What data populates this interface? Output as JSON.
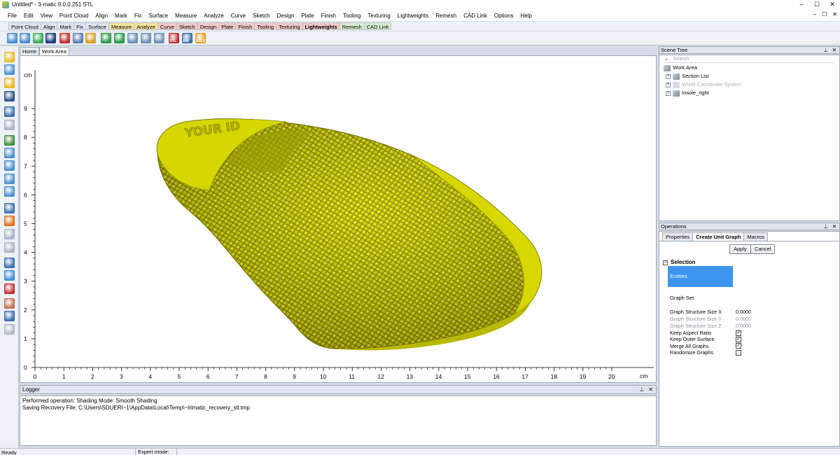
{
  "window": {
    "title": "Untitled* - 3-matic 9.0.0.251 STL",
    "controls": [
      "–",
      "☐",
      "✕"
    ]
  },
  "menubar": {
    "items": [
      "File",
      "Edit",
      "View",
      "Point Cloud",
      "Align",
      "Mark",
      "Fix",
      "Surface",
      "Measure",
      "Analyze",
      "Curve",
      "Sketch",
      "Design",
      "Plate",
      "Finish",
      "Tooling",
      "Texturing",
      "Lightweights",
      "Remesh",
      "CAD Link",
      "Options",
      "Help"
    ],
    "right": [
      "–",
      "☐",
      "✕"
    ]
  },
  "tabstrip": {
    "tabs": [
      {
        "label": "Point Cloud",
        "color": "#dfe7f3",
        "bold": false
      },
      {
        "label": "Align",
        "color": "#dfe7f3",
        "bold": false
      },
      {
        "label": "Mark",
        "color": "#dfe7f3",
        "bold": false
      },
      {
        "label": "Fix",
        "color": "#dfe7f3",
        "bold": false
      },
      {
        "label": "Surface",
        "color": "#dfe7f3",
        "bold": false
      },
      {
        "label": "Measure",
        "color": "#f4e39b",
        "bold": false
      },
      {
        "label": "Analyze",
        "color": "#f4e39b",
        "bold": false
      },
      {
        "label": "Curve",
        "color": "#f2c9c9",
        "bold": false
      },
      {
        "label": "Sketch",
        "color": "#f2c9c9",
        "bold": false
      },
      {
        "label": "Design",
        "color": "#f2c9c9",
        "bold": false
      },
      {
        "label": "Plate",
        "color": "#f2c9c9",
        "bold": false
      },
      {
        "label": "Finish",
        "color": "#f2c9c9",
        "bold": false
      },
      {
        "label": "Tooling",
        "color": "#f2c9c9",
        "bold": false
      },
      {
        "label": "Texturing",
        "color": "#f2c9c9",
        "bold": false
      },
      {
        "label": "Lightweights",
        "color": "#f2c9c9",
        "bold": true
      },
      {
        "label": "Remesh",
        "color": "#d9edd0",
        "bold": false
      },
      {
        "label": "CAD Link",
        "color": "#d9edd0",
        "bold": false
      }
    ]
  },
  "iconbar": {
    "icons": [
      {
        "name": "graph-icon-1",
        "color": "#4a8fd0"
      },
      {
        "name": "graph-icon-2",
        "color": "#4a8fd0"
      },
      {
        "name": "graph-icon-3",
        "color": "#3aa85a"
      },
      {
        "name": "graph-icon-4",
        "color": "#1d3d7a"
      },
      {
        "name": "graph-icon-5",
        "color": "#c03030"
      },
      {
        "name": "graph-icon-6",
        "color": "#5a7fb0"
      },
      {
        "name": "arrow-import-icon",
        "color": "#e0a020"
      },
      {
        "name": "lattice-icon-1",
        "color": "#2e9a4a"
      },
      {
        "name": "lattice-icon-2",
        "color": "#2e9a4a"
      },
      {
        "name": "lattice-icon-3",
        "color": "#6c8fb8"
      },
      {
        "name": "lattice-icon-4",
        "color": "#6c8fb8"
      },
      {
        "name": "lattice-icon-5",
        "color": "#6c8fb8"
      },
      {
        "name": "export-stl-icon",
        "color": "#c03030"
      },
      {
        "name": "export-am-icon",
        "color": "#3c6fb0"
      },
      {
        "name": "export-iges-icon",
        "color": "#e0a020"
      }
    ],
    "export_labels": [
      "STL",
      "AM",
      "IGES"
    ]
  },
  "lefttools": {
    "icons": [
      {
        "name": "open-folder-icon",
        "color": "#e8b92a"
      },
      {
        "name": "new-file-icon",
        "color": "#4a8fd0"
      },
      {
        "name": "import-folder-icon",
        "color": "#e8b92a"
      },
      {
        "name": "save-icon",
        "color": "#2d4e84"
      },
      {
        "name": "undo-icon",
        "color": "#3c6fb0"
      },
      {
        "name": "redo-icon",
        "color": "#a8b4c4"
      },
      {
        "name": "select-icon",
        "color": "#3e8e40"
      },
      {
        "name": "pan-icon",
        "color": "#4a8fd0"
      },
      {
        "name": "rotate-icon",
        "color": "#4a8fd0"
      },
      {
        "name": "zoom-icon",
        "color": "#4a8fd0"
      },
      {
        "name": "zoom-fit-icon",
        "color": "#4a8fd0"
      },
      {
        "name": "view-icon",
        "color": "#3c6fb0"
      },
      {
        "name": "shading-icon",
        "color": "#e07020"
      },
      {
        "name": "render-icon",
        "color": "#a8b4c4"
      },
      {
        "name": "section-icon",
        "color": "#a8b4c4"
      },
      {
        "name": "cube-view-icon",
        "color": "#3c6fb0"
      },
      {
        "name": "sphere-icon",
        "color": "#3d8de0"
      },
      {
        "name": "box-red-icon",
        "color": "#c03030"
      },
      {
        "name": "axis-icon",
        "color": "#c07050"
      },
      {
        "name": "measure-icon",
        "color": "#3c6fb0"
      },
      {
        "name": "grid-icon",
        "color": "#b0b8c4"
      }
    ]
  },
  "doctabs": [
    {
      "label": "Home",
      "active": false
    },
    {
      "label": "Work Area",
      "active": true
    }
  ],
  "viewport": {
    "unit": "cm",
    "x_ticks": [
      "0",
      "1",
      "2",
      "3",
      "4",
      "5",
      "6",
      "7",
      "8",
      "9",
      "10",
      "11",
      "12",
      "13",
      "14",
      "15",
      "16",
      "17",
      "18",
      "19",
      "20"
    ],
    "y_ticks": [
      "0",
      "1",
      "2",
      "3",
      "4",
      "5",
      "6",
      "7",
      "8",
      "9"
    ],
    "model_color": "#d8d800",
    "model_shadow": "#7e7e00",
    "model_text": "YOUR ID"
  },
  "logger": {
    "title": "Logger",
    "lines": [
      "Performed operation: Shading Mode: Smooth Shading",
      "Saving Recovery File: C:\\Users\\SDUERI~1\\AppData\\Local\\Temp\\~trimatic_recovery_stl.tmp"
    ],
    "pins": [
      "⊥",
      "✕"
    ]
  },
  "status": {
    "ready": "Ready",
    "expert": "Expert mode: OFF"
  },
  "scene_tree": {
    "title": "Scene Tree",
    "pins": [
      "⊥",
      "✕"
    ],
    "search_placeholder": "Search",
    "nodes": [
      {
        "label": "Work Area",
        "level": 0,
        "expander": "",
        "dim": false
      },
      {
        "label": "Section List",
        "level": 1,
        "expander": "+",
        "dim": false
      },
      {
        "label": "World Coordinate System",
        "level": 1,
        "expander": "+",
        "dim": true
      },
      {
        "label": "Insole_right",
        "level": 1,
        "expander": "+",
        "dim": false
      }
    ]
  },
  "operations": {
    "title": "Operations",
    "pins": [
      "⊥",
      "✕"
    ],
    "tabs": [
      {
        "label": "Properties",
        "active": false
      },
      {
        "label": "Create Unit Graph",
        "active": true
      },
      {
        "label": "Macros",
        "active": false
      }
    ],
    "apply": "Apply",
    "cancel": "Cancel",
    "section": "Selection",
    "section_toggle": "−",
    "entities": "Entities",
    "graph_set": "Graph Set",
    "sizes": [
      {
        "label": "Graph Structure Size X",
        "value": "0.0000",
        "dim": false
      },
      {
        "label": "Graph Structure Size Y",
        "value": "0.0000",
        "dim": true
      },
      {
        "label": "Graph Structure Size Z",
        "value": "0.0000",
        "dim": true
      }
    ],
    "checks": [
      {
        "label": "Keep Aspect Ratio",
        "checked": true
      },
      {
        "label": "Keep Outer Surface",
        "checked": true
      },
      {
        "label": "Merge All Graphs",
        "checked": true
      },
      {
        "label": "Randomize Graphs",
        "checked": false
      }
    ]
  }
}
